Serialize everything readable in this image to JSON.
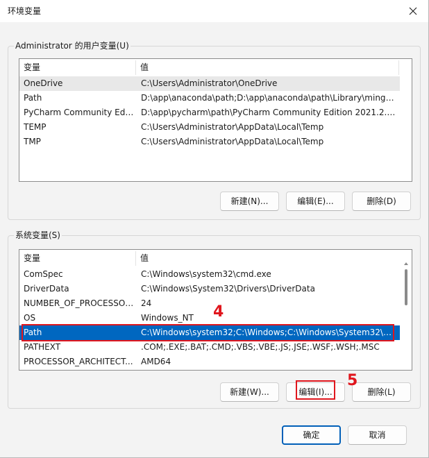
{
  "window": {
    "title": "环境变量"
  },
  "user_vars": {
    "label": "Administrator 的用户变量(U)",
    "col_var": "变量",
    "col_val": "值",
    "rows": [
      {
        "name": "OneDrive",
        "value": "C:\\Users\\Administrator\\OneDrive"
      },
      {
        "name": "Path",
        "value": "D:\\app\\anaconda\\path;D:\\app\\anaconda\\path\\Library\\mingw..."
      },
      {
        "name": "PyCharm Community Editi...",
        "value": "D:\\app\\pycharm\\path\\PyCharm Community Edition 2021.2.4\\..."
      },
      {
        "name": "TEMP",
        "value": "C:\\Users\\Administrator\\AppData\\Local\\Temp"
      },
      {
        "name": "TMP",
        "value": "C:\\Users\\Administrator\\AppData\\Local\\Temp"
      }
    ],
    "new_btn": "新建(N)...",
    "edit_btn": "编辑(E)...",
    "delete_btn": "删除(D)"
  },
  "sys_vars": {
    "label": "系统变量(S)",
    "col_var": "变量",
    "col_val": "值",
    "rows": [
      {
        "name": "ComSpec",
        "value": "C:\\Windows\\system32\\cmd.exe"
      },
      {
        "name": "DriverData",
        "value": "C:\\Windows\\System32\\Drivers\\DriverData"
      },
      {
        "name": "NUMBER_OF_PROCESSORS",
        "value": "24"
      },
      {
        "name": "OS",
        "value": "Windows_NT"
      },
      {
        "name": "Path",
        "value": "C:\\Windows\\system32;C:\\Windows;C:\\Windows\\System32\\Wb..."
      },
      {
        "name": "PATHEXT",
        "value": ".COM;.EXE;.BAT;.CMD;.VBS;.VBE;.JS;.JSE;.WSF;.WSH;.MSC"
      },
      {
        "name": "PROCESSOR_ARCHITECT...",
        "value": "AMD64"
      }
    ],
    "new_btn": "新建(W)...",
    "edit_btn": "编辑(I)...",
    "delete_btn": "删除(L)"
  },
  "ok_btn": "确定",
  "cancel_btn": "取消",
  "annotations": {
    "step4": "4",
    "step5": "5",
    "color": "#e0161d"
  },
  "colors": {
    "selection": "#0067c0",
    "accent": "#005fb8"
  },
  "icons": {
    "close": "close-icon"
  }
}
